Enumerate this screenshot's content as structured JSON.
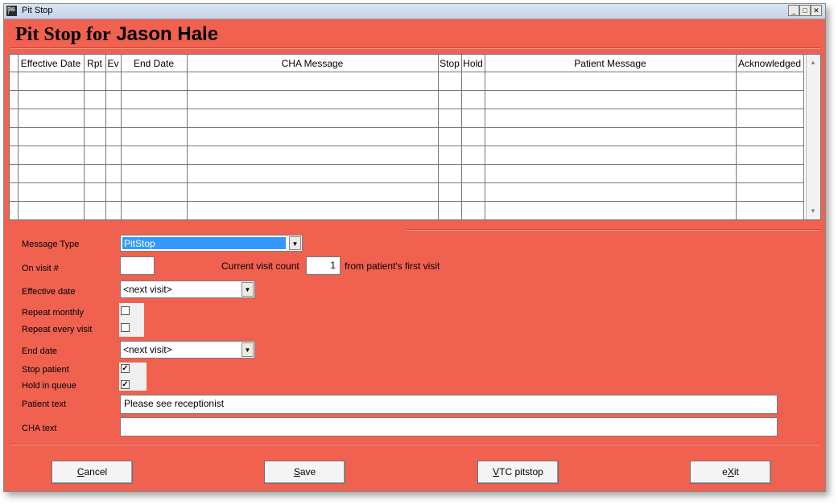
{
  "window": {
    "title": "Pit Stop",
    "app_icon": "app-icon"
  },
  "heading": {
    "prefix": "Pit Stop for",
    "patient_name": "Jason Hale"
  },
  "grid": {
    "columns": [
      "Effective Date",
      "Rpt",
      "Ev",
      "End Date",
      "CHA Message",
      "Stop",
      "Hold",
      "Patient Message",
      "Acknowledged"
    ],
    "rows": [
      [
        "",
        "",
        "",
        "",
        "",
        "",
        "",
        "",
        ""
      ],
      [
        "",
        "",
        "",
        "",
        "",
        "",
        "",
        "",
        ""
      ],
      [
        "",
        "",
        "",
        "",
        "",
        "",
        "",
        "",
        ""
      ],
      [
        "",
        "",
        "",
        "",
        "",
        "",
        "",
        "",
        ""
      ],
      [
        "",
        "",
        "",
        "",
        "",
        "",
        "",
        "",
        ""
      ],
      [
        "",
        "",
        "",
        "",
        "",
        "",
        "",
        "",
        ""
      ],
      [
        "",
        "",
        "",
        "",
        "",
        "",
        "",
        "",
        ""
      ],
      [
        "",
        "",
        "",
        "",
        "",
        "",
        "",
        "",
        ""
      ]
    ]
  },
  "form": {
    "message_type_label": "Message Type",
    "message_type_value": "PitStop",
    "on_visit_label": "On visit #",
    "on_visit_value": "",
    "current_visit_label": "Current visit count",
    "current_visit_value": "1",
    "from_first_visit_label": "from patient's first visit",
    "effective_date_label": "Effective date",
    "effective_date_value": "<next visit>",
    "repeat_monthly_label": "Repeat monthly",
    "repeat_monthly_checked": false,
    "repeat_every_visit_label": "Repeat every visit",
    "repeat_every_visit_checked": false,
    "end_date_label": "End date",
    "end_date_value": "<next visit>",
    "stop_patient_label": "Stop patient",
    "stop_patient_checked": true,
    "hold_in_queue_label": "Hold in queue",
    "hold_in_queue_checked": true,
    "patient_text_label": "Patient text",
    "patient_text_value": "Please see receptionist",
    "cha_text_label": "CHA text",
    "cha_text_value": ""
  },
  "buttons": {
    "cancel": {
      "mnemonic": "C",
      "rest": "ancel"
    },
    "save": {
      "mnemonic": "S",
      "rest": "ave"
    },
    "vtc_pitstop": {
      "mnemonic": "V",
      "rest": "TC pitstop"
    },
    "exit": {
      "pre": "e",
      "mnemonic": "X",
      "rest": "it"
    }
  },
  "colors": {
    "background": "#f0614f",
    "selection": "#3399ff"
  }
}
